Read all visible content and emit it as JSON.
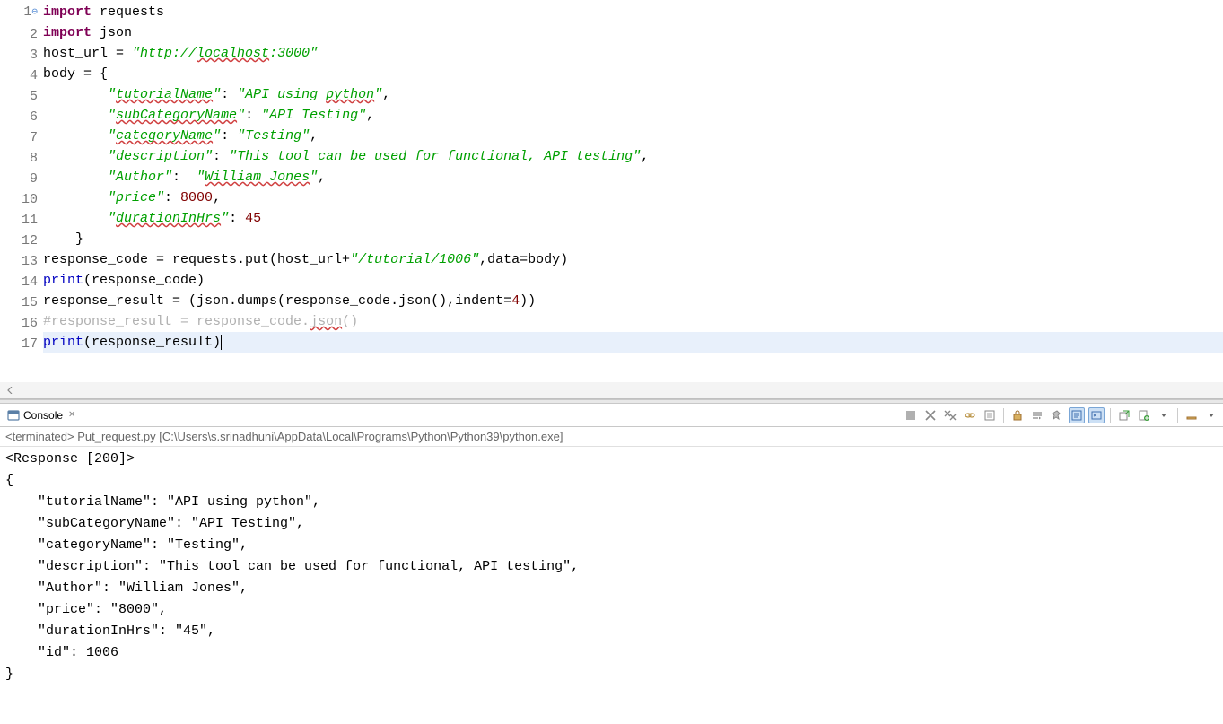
{
  "editor": {
    "line_numbers": [
      "1",
      "2",
      "3",
      "4",
      "5",
      "6",
      "7",
      "8",
      "9",
      "10",
      "11",
      "12",
      "13",
      "14",
      "15",
      "16",
      "17"
    ],
    "code_lines": [
      {
        "n": 1,
        "tokens": [
          {
            "t": "import",
            "c": "kw"
          },
          {
            "t": " ",
            "c": "nm"
          },
          {
            "t": "requests",
            "c": "nm"
          }
        ]
      },
      {
        "n": 2,
        "tokens": [
          {
            "t": "import",
            "c": "kw"
          },
          {
            "t": " ",
            "c": "nm"
          },
          {
            "t": "json",
            "c": "nm"
          }
        ]
      },
      {
        "n": 3,
        "tokens": [
          {
            "t": "host_url = ",
            "c": "nm"
          },
          {
            "t": "\"http://",
            "c": "str"
          },
          {
            "t": "localhost",
            "c": "str",
            "sq": true
          },
          {
            "t": ":3000\"",
            "c": "str"
          }
        ]
      },
      {
        "n": 4,
        "tokens": [
          {
            "t": "body = {",
            "c": "nm"
          }
        ]
      },
      {
        "n": 5,
        "tokens": [
          {
            "t": "        ",
            "c": "nm"
          },
          {
            "t": "\"",
            "c": "str"
          },
          {
            "t": "tutorialName",
            "c": "str",
            "sq": true
          },
          {
            "t": "\"",
            "c": "str"
          },
          {
            "t": ": ",
            "c": "nm"
          },
          {
            "t": "\"API using ",
            "c": "str"
          },
          {
            "t": "python",
            "c": "str",
            "sq": true
          },
          {
            "t": "\"",
            "c": "str"
          },
          {
            "t": ",",
            "c": "nm"
          }
        ]
      },
      {
        "n": 6,
        "tokens": [
          {
            "t": "        ",
            "c": "nm"
          },
          {
            "t": "\"",
            "c": "str"
          },
          {
            "t": "subCategoryName",
            "c": "str",
            "sq": true
          },
          {
            "t": "\"",
            "c": "str"
          },
          {
            "t": ": ",
            "c": "nm"
          },
          {
            "t": "\"API Testing\"",
            "c": "str"
          },
          {
            "t": ",",
            "c": "nm"
          }
        ]
      },
      {
        "n": 7,
        "tokens": [
          {
            "t": "        ",
            "c": "nm"
          },
          {
            "t": "\"",
            "c": "str"
          },
          {
            "t": "categoryName",
            "c": "str",
            "sq": true
          },
          {
            "t": "\"",
            "c": "str"
          },
          {
            "t": ": ",
            "c": "nm"
          },
          {
            "t": "\"Testing\"",
            "c": "str"
          },
          {
            "t": ",",
            "c": "nm"
          }
        ]
      },
      {
        "n": 8,
        "tokens": [
          {
            "t": "        ",
            "c": "nm"
          },
          {
            "t": "\"description\"",
            "c": "str"
          },
          {
            "t": ": ",
            "c": "nm"
          },
          {
            "t": "\"This tool can be used for functional, API testing\"",
            "c": "str"
          },
          {
            "t": ",",
            "c": "nm"
          }
        ]
      },
      {
        "n": 9,
        "tokens": [
          {
            "t": "        ",
            "c": "nm"
          },
          {
            "t": "\"Author\"",
            "c": "str"
          },
          {
            "t": ":  ",
            "c": "nm"
          },
          {
            "t": "\"",
            "c": "str"
          },
          {
            "t": "William Jones",
            "c": "str",
            "sq": true
          },
          {
            "t": "\"",
            "c": "str"
          },
          {
            "t": ",",
            "c": "nm"
          }
        ]
      },
      {
        "n": 10,
        "tokens": [
          {
            "t": "        ",
            "c": "nm"
          },
          {
            "t": "\"price\"",
            "c": "str"
          },
          {
            "t": ": ",
            "c": "nm"
          },
          {
            "t": "8000",
            "c": "num"
          },
          {
            "t": ",",
            "c": "nm"
          }
        ]
      },
      {
        "n": 11,
        "tokens": [
          {
            "t": "        ",
            "c": "nm"
          },
          {
            "t": "\"",
            "c": "str"
          },
          {
            "t": "durationInHrs",
            "c": "str",
            "sq": true
          },
          {
            "t": "\"",
            "c": "str"
          },
          {
            "t": ": ",
            "c": "nm"
          },
          {
            "t": "45",
            "c": "num"
          }
        ]
      },
      {
        "n": 12,
        "tokens": [
          {
            "t": "    }",
            "c": "nm"
          }
        ]
      },
      {
        "n": 13,
        "tokens": [
          {
            "t": "response_code = requests.put(host_url+",
            "c": "nm"
          },
          {
            "t": "\"/tutorial/1006\"",
            "c": "str"
          },
          {
            "t": ",data=body)",
            "c": "nm"
          }
        ]
      },
      {
        "n": 14,
        "tokens": [
          {
            "t": "print",
            "c": "fn"
          },
          {
            "t": "(response_code)",
            "c": "nm"
          }
        ]
      },
      {
        "n": 15,
        "tokens": [
          {
            "t": "response_result = (json.dumps(response_code.json(),indent=",
            "c": "nm"
          },
          {
            "t": "4",
            "c": "num"
          },
          {
            "t": "))",
            "c": "nm"
          }
        ]
      },
      {
        "n": 16,
        "tokens": [
          {
            "t": "#response_result = response_code.",
            "c": "cmt"
          },
          {
            "t": "json",
            "c": "cmt",
            "sq": true
          },
          {
            "t": "()",
            "c": "cmt"
          }
        ]
      },
      {
        "n": 17,
        "current": true,
        "tokens": [
          {
            "t": "print",
            "c": "fn"
          },
          {
            "t": "(response_result)",
            "c": "nm"
          }
        ]
      }
    ]
  },
  "console": {
    "tab_label": "Console",
    "terminated_header": "<terminated> Put_request.py [C:\\Users\\s.srinadhuni\\AppData\\Local\\Programs\\Python\\Python39\\python.exe]",
    "output": "<Response [200]>\n{\n    \"tutorialName\": \"API using python\",\n    \"subCategoryName\": \"API Testing\",\n    \"categoryName\": \"Testing\",\n    \"description\": \"This tool can be used for functional, API testing\",\n    \"Author\": \"William Jones\",\n    \"price\": \"8000\",\n    \"durationInHrs\": \"45\",\n    \"id\": 1006\n}"
  }
}
